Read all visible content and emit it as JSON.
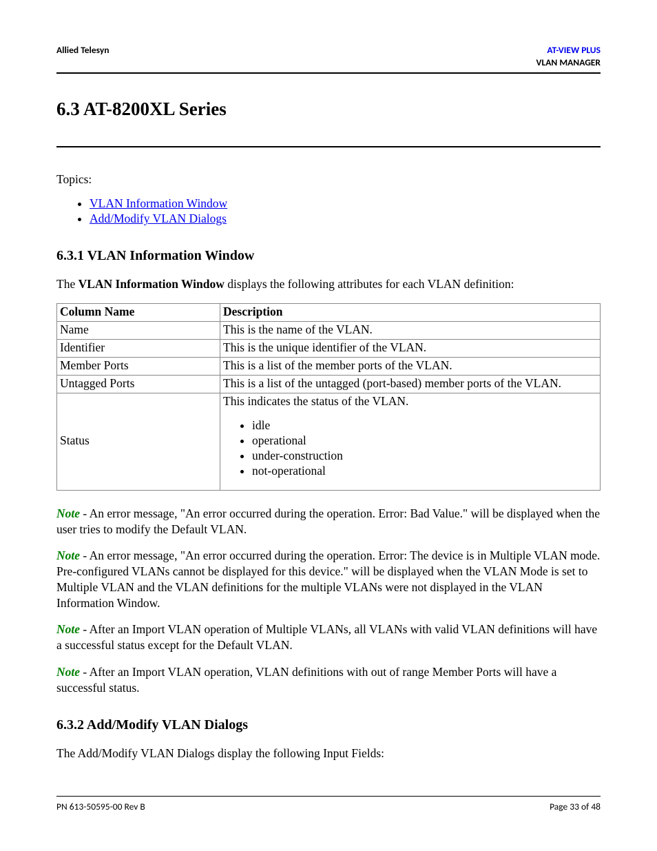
{
  "header": {
    "left": "Allied Telesyn",
    "right_line1": "AT-VIEW PLUS",
    "right_line2": "VLAN MANAGER"
  },
  "section_title": "6.3 AT-8200XL Series",
  "topics_label": "Topics:",
  "topic_links": [
    "VLAN Information Window",
    "Add/Modify VLAN Dialogs"
  ],
  "sub1": {
    "heading": "6.3.1 VLAN Information Window",
    "intro_pre": "The ",
    "intro_bold": "VLAN Information Window",
    "intro_post": " displays the following attributes for each VLAN definition:",
    "table": {
      "head_col": "Column Name",
      "head_desc": "Description",
      "rows": [
        {
          "col": "Name",
          "desc": "This is the name of the VLAN."
        },
        {
          "col": "Identifier",
          "desc": "This is the unique identifier of the VLAN."
        },
        {
          "col": "Member Ports",
          "desc": "This is a list of the member ports of the VLAN."
        },
        {
          "col": "Untagged Ports",
          "desc": "This is a list of the untagged (port-based) member ports of the VLAN."
        }
      ],
      "status_row": {
        "col": "Status",
        "desc_intro": "This indicates the status of the VLAN.",
        "items": [
          "idle",
          "operational",
          "under-construction",
          "not-operational"
        ]
      }
    }
  },
  "notes": {
    "word": "Note",
    "n1": " - An error message, \"An error occurred during the operation. Error: Bad Value.\" will be displayed when the user tries to modify the Default VLAN.",
    "n2": " - An error message, \"An error occurred during the operation. Error: The device is in Multiple VLAN mode. Pre-configured VLANs cannot be displayed for this device.\" will be displayed when the VLAN Mode is set to Multiple VLAN and the VLAN definitions for the multiple VLANs were not displayed in the VLAN Information Window.",
    "n3": " - After an Import VLAN operation of Multiple VLANs, all VLANs with valid VLAN definitions will have a successful status except for the Default VLAN.",
    "n4": " - After an Import VLAN operation, VLAN definitions with out of range Member Ports will have a successful status."
  },
  "sub2": {
    "heading": "6.3.2 Add/Modify VLAN Dialogs",
    "intro": "The Add/Modify VLAN Dialogs display the following Input Fields:"
  },
  "footer": {
    "left": "PN 613-50595-00 Rev B",
    "right": "Page 33 of 48"
  }
}
